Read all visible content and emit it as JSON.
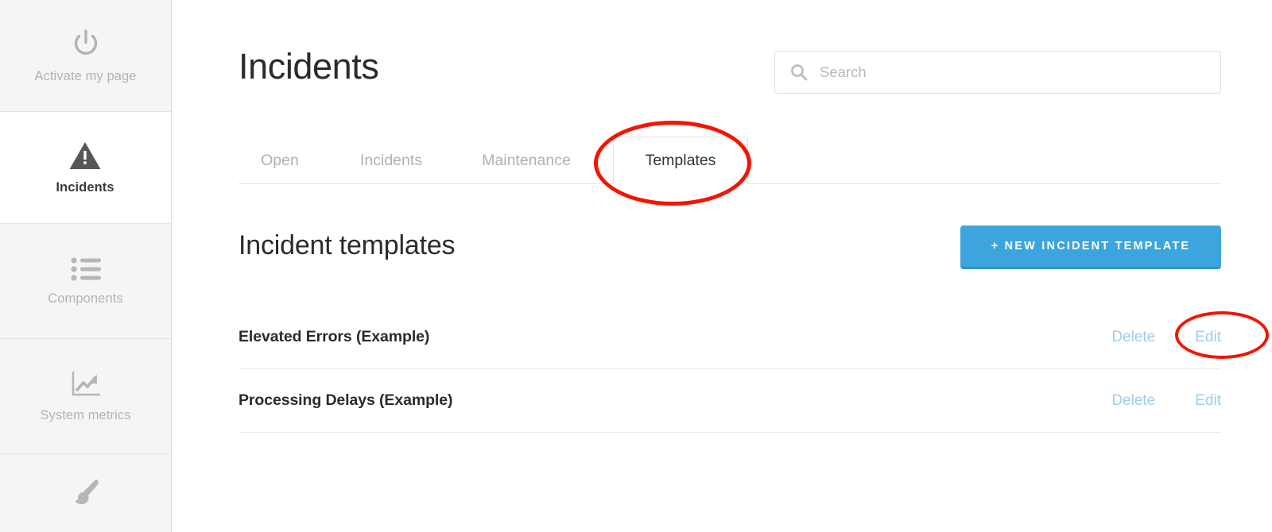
{
  "sidebar": {
    "items": [
      {
        "label": "Activate my page",
        "icon": "power-icon",
        "id": "activate",
        "active": false
      },
      {
        "label": "Incidents",
        "icon": "warning-triangle-icon",
        "id": "incidents",
        "active": true
      },
      {
        "label": "Components",
        "icon": "list-icon",
        "id": "components",
        "active": false
      },
      {
        "label": "System metrics",
        "icon": "chart-line-icon",
        "id": "metrics",
        "active": false
      },
      {
        "label": "",
        "icon": "paintbrush-icon",
        "id": "customize",
        "active": false
      }
    ]
  },
  "header": {
    "title": "Incidents"
  },
  "search": {
    "placeholder": "Search",
    "value": "",
    "icon": "search-icon"
  },
  "tabs": [
    {
      "label": "Open",
      "active": false
    },
    {
      "label": "Incidents",
      "active": false
    },
    {
      "label": "Maintenance",
      "active": false
    },
    {
      "label": "Templates",
      "active": true
    }
  ],
  "section": {
    "title": "Incident templates",
    "new_button_label": "+ New incident template"
  },
  "templates": [
    {
      "name": "Elevated Errors (Example)",
      "delete_label": "Delete",
      "edit_label": "Edit"
    },
    {
      "name": "Processing Delays (Example)",
      "delete_label": "Delete",
      "edit_label": "Edit"
    }
  ],
  "annotations": [
    {
      "target": "templates-tab",
      "shape": "ellipse",
      "color": "#f51400"
    },
    {
      "target": "edit-link-row-1",
      "shape": "ellipse",
      "color": "#f51400"
    }
  ],
  "colors": {
    "accent_blue": "#3da5dd",
    "link_blue": "#9ccdee",
    "annotation_red": "#f51400",
    "sidebar_bg": "#f5f5f5",
    "text_dark": "#2b2b2b",
    "text_muted": "#b0b0b0"
  }
}
